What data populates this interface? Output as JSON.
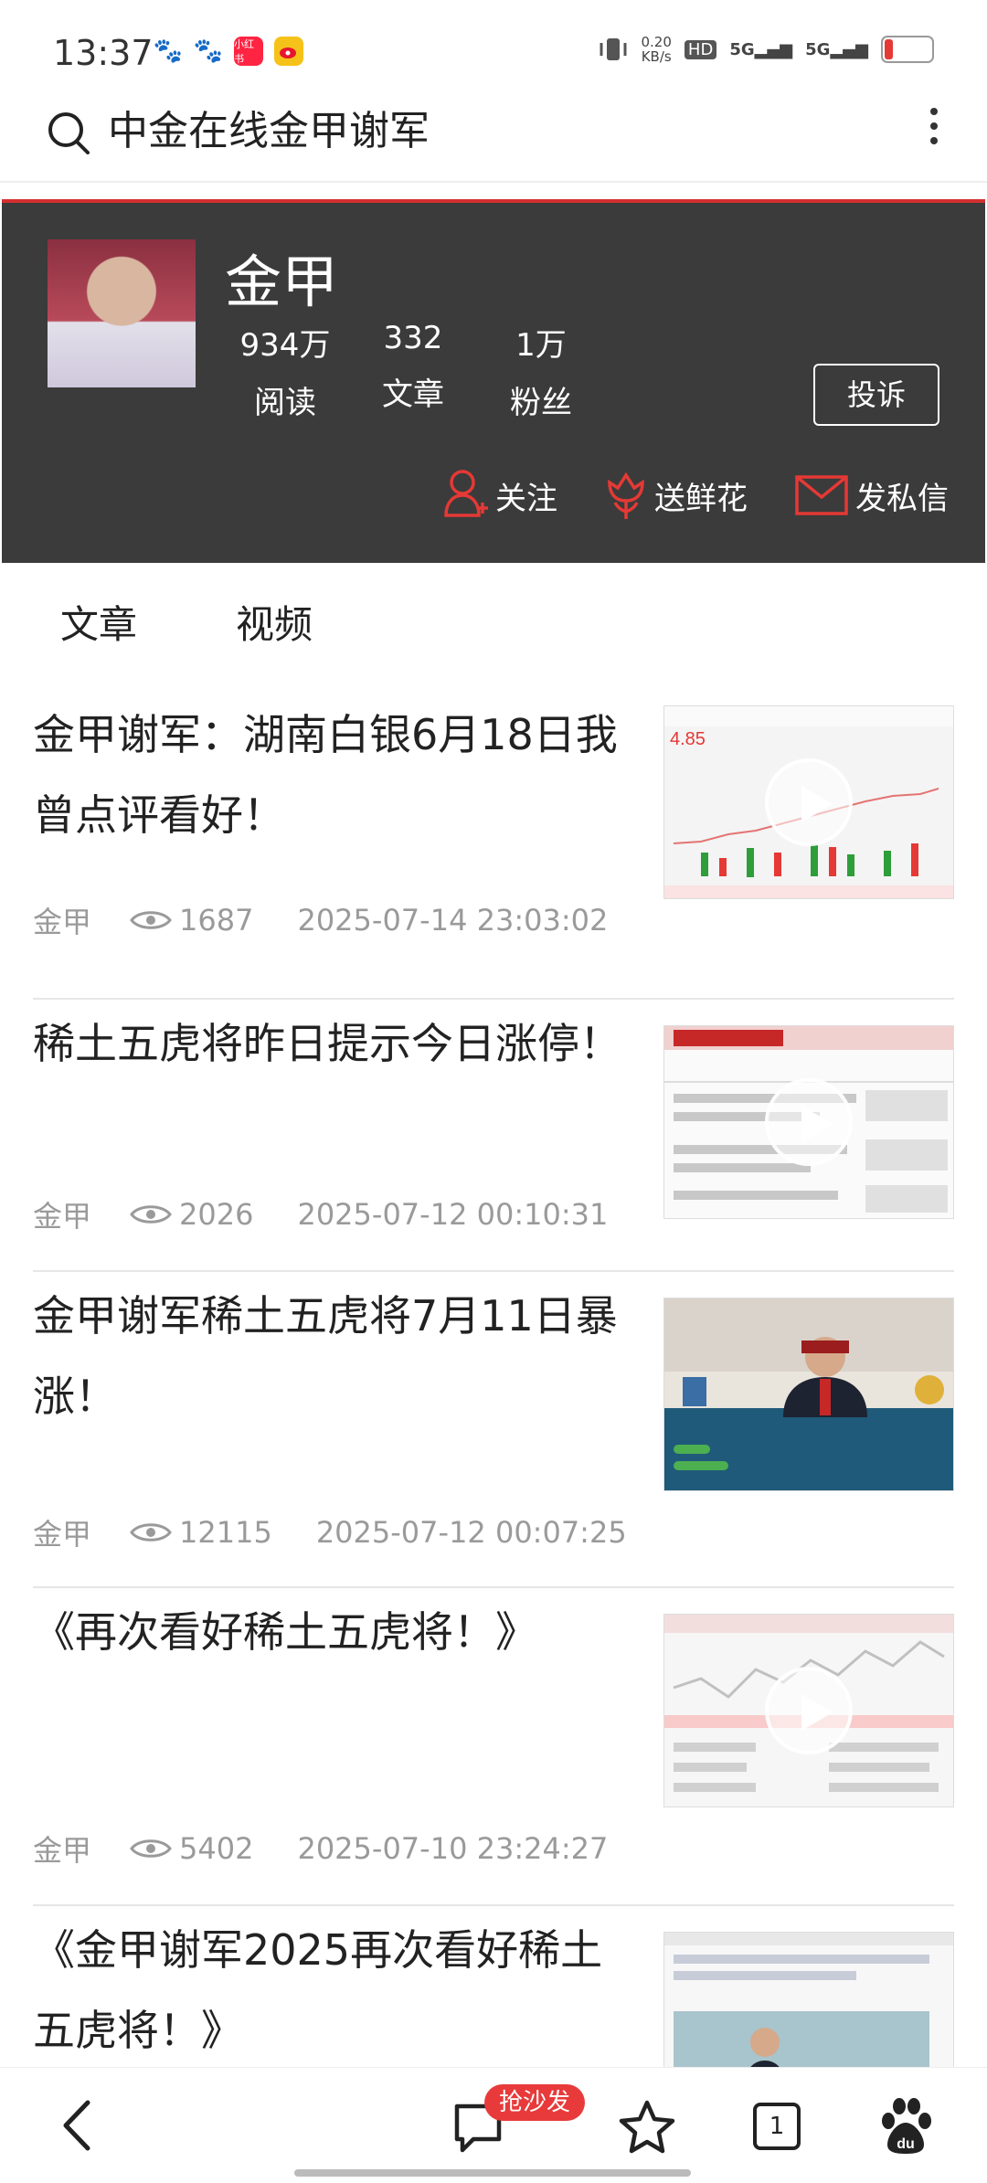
{
  "status_bar": {
    "time": "13:37",
    "net_speed": "0.20\nKB/s",
    "hd": "HD",
    "signal1": "5G",
    "signal2": "5G",
    "app_icons": [
      "baidu-paw-icon",
      "baidu-paw-icon",
      "xiaohongshu-icon",
      "weibo-icon"
    ],
    "xiaohongshu_label": "小红书"
  },
  "search": {
    "query": "中金在线金甲谢军"
  },
  "profile": {
    "name": "金甲",
    "stats": [
      {
        "num": "934万",
        "label": "阅读"
      },
      {
        "num": "332",
        "label": "文章"
      },
      {
        "num": "1万",
        "label": "粉丝"
      }
    ],
    "complain_label": "投诉",
    "actions": {
      "follow": "关注",
      "flower": "送鲜花",
      "message": "发私信"
    },
    "accent_color": "#d32f2f"
  },
  "tabs": [
    "文章",
    "视频"
  ],
  "articles": [
    {
      "title": "金甲谢军：湖南白银6月18日我曾点评看好！",
      "author": "金甲",
      "views": "1687",
      "date": "2025-07-14 23:03:02"
    },
    {
      "title": "稀土五虎将昨日提示今日涨停！",
      "author": "金甲",
      "views": "2026",
      "date": "2025-07-12 00:10:31"
    },
    {
      "title": "金甲谢军稀土五虎将7月11日暴涨！",
      "author": "金甲",
      "views": "12115",
      "date": "2025-07-12 00:07:25"
    },
    {
      "title": "《再次看好稀土五虎将！》",
      "author": "金甲",
      "views": "5402",
      "date": "2025-07-10 23:24:27"
    },
    {
      "title": "《金甲谢军2025再次看好稀土五虎将！》"
    }
  ],
  "bottom_nav": {
    "badge": "抢沙发",
    "tab_count": "1"
  }
}
